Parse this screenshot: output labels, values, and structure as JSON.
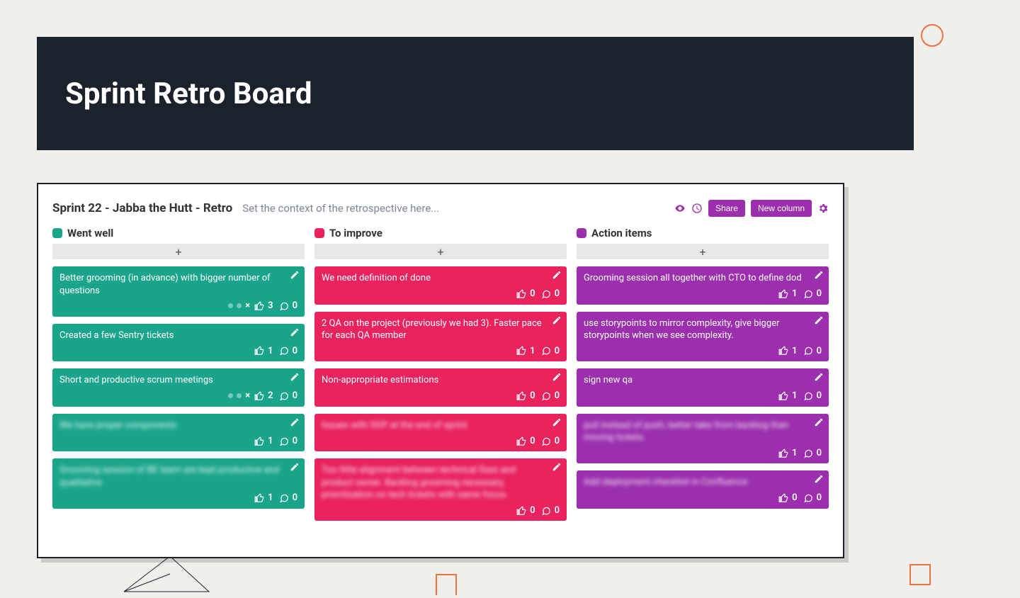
{
  "page_title": "Sprint Retro Board",
  "board": {
    "title": "Sprint 22 - Jabba the Hutt - Retro",
    "context_placeholder": "Set the context of the retrospective here...",
    "share_label": "Share",
    "new_column_label": "New column"
  },
  "columns": [
    {
      "id": "went_well",
      "title": "Went well",
      "color": "#1aa58a",
      "card_class": "teal",
      "cards": [
        {
          "text": "Better grooming (in advance) with bigger number of questions",
          "likes": 3,
          "comments": 0,
          "merged": true,
          "blurred": false
        },
        {
          "text": "Created a few Sentry tickets",
          "likes": 1,
          "comments": 0,
          "merged": false,
          "blurred": false
        },
        {
          "text": "Short and productive scrum meetings",
          "likes": 2,
          "comments": 0,
          "merged": true,
          "blurred": false
        },
        {
          "text": "We have proper components",
          "likes": 1,
          "comments": 0,
          "merged": false,
          "blurred": true
        },
        {
          "text": "Grooming session of BE team are kept productive and qualitative",
          "likes": 1,
          "comments": 0,
          "merged": false,
          "blurred": true
        }
      ]
    },
    {
      "id": "to_improve",
      "title": "To improve",
      "color": "#e8235e",
      "card_class": "pink",
      "cards": [
        {
          "text": "We need definition of done",
          "likes": 0,
          "comments": 0,
          "merged": false,
          "blurred": false
        },
        {
          "text": "2 QA on the project (previously we had 3). Faster pace for each QA member",
          "likes": 1,
          "comments": 0,
          "merged": false,
          "blurred": false
        },
        {
          "text": "Non-appropriate estimations",
          "likes": 0,
          "comments": 0,
          "merged": false,
          "blurred": false
        },
        {
          "text": "Issues with SOP at the end of sprint",
          "likes": 0,
          "comments": 0,
          "merged": false,
          "blurred": true
        },
        {
          "text": "Too little alignment between technical fixes and product owner. Backlog grooming necessary, prioritisation on tech tickets with same focus.",
          "likes": 0,
          "comments": 0,
          "merged": false,
          "blurred": true
        }
      ]
    },
    {
      "id": "action_items",
      "title": "Action items",
      "color": "#9b2fae",
      "card_class": "purple",
      "cards": [
        {
          "text": "Grooming session all together with CTO to define dod",
          "likes": 1,
          "comments": 0,
          "merged": false,
          "blurred": false
        },
        {
          "text": "use storypoints to mirror complexity, give bigger storypoints when we see complexity.",
          "likes": 1,
          "comments": 0,
          "merged": false,
          "blurred": false
        },
        {
          "text": "sign new qa",
          "likes": 1,
          "comments": 0,
          "merged": false,
          "blurred": false
        },
        {
          "text": "pull instead of push, better take from backlog than moving tickets",
          "likes": 1,
          "comments": 0,
          "merged": false,
          "blurred": true
        },
        {
          "text": "Add deployment checklist in Confluence",
          "likes": 0,
          "comments": 0,
          "merged": false,
          "blurred": true
        }
      ]
    }
  ]
}
